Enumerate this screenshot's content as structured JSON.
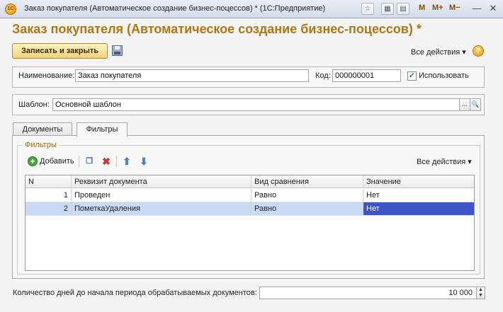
{
  "window": {
    "title": "Заказ покупателя (Автоматическое создание бизнес-поцессов) *  (1С:Предприятие)",
    "app_icon_text": "1С",
    "buttons": {
      "m": "M",
      "m_plus": "M+",
      "m_minus": "M−",
      "minimize": "—",
      "close": "✕"
    }
  },
  "form": {
    "title": "Заказ покупателя (Автоматическое создание бизнес-поцессов) *",
    "save_close_label": "Записать и закрыть",
    "all_actions_label": "Все действия ▾",
    "help_label": "?"
  },
  "fields": {
    "name_label": "Наименование:",
    "name_value": "Заказ покупателя",
    "code_label": "Код:",
    "code_value": "000000001",
    "use_label": "Использовать",
    "use_checked": true,
    "template_label": "Шаблон:",
    "template_value": "Основной шаблон",
    "template_select_label": "...",
    "template_open_label": "🔍"
  },
  "tabs": [
    {
      "label": "Документы",
      "active": false
    },
    {
      "label": "Фильтры",
      "active": true
    }
  ],
  "filters": {
    "legend": "Фильтры",
    "add_label": "Добавить",
    "all_actions_label": "Все действия ▾",
    "columns": [
      "N",
      "Реквизит документа",
      "Вид сравнения",
      "Значение"
    ],
    "rows": [
      {
        "n": "1",
        "attr": "Проведен",
        "cmp": "Равно",
        "value": "Нет",
        "selected": false
      },
      {
        "n": "2",
        "attr": "ПометкаУдаления",
        "cmp": "Равно",
        "value": "Нет",
        "selected": true
      }
    ]
  },
  "bottom": {
    "days_label": "Количество дней до начала периода обрабатываемых документов:",
    "days_value": "10 000"
  },
  "colors": {
    "title_accent": "#b2760f",
    "selection_row": "#c9daf5",
    "selection_cell": "#3d54c8"
  }
}
